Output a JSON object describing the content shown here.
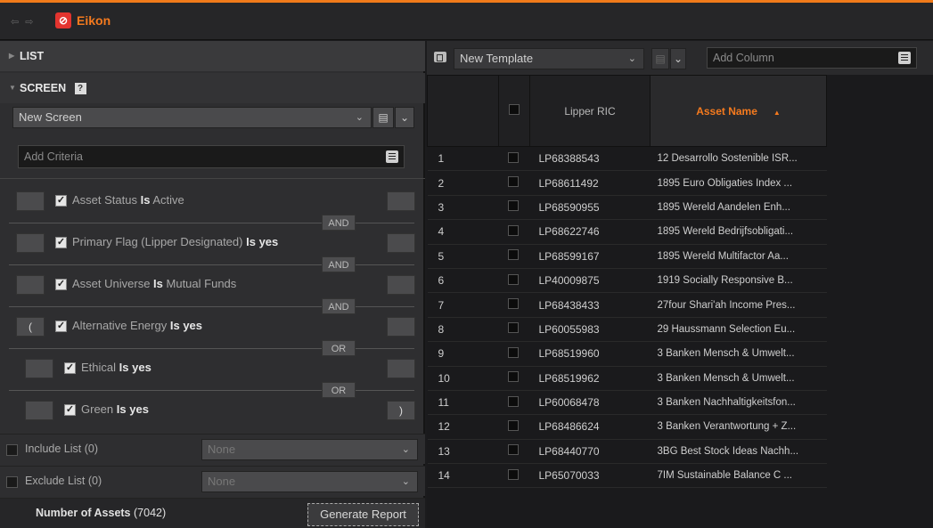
{
  "app": {
    "title": "Eikon",
    "nav": "⇦ ⇨"
  },
  "left": {
    "list_header": "LIST",
    "screen_header": "SCREEN",
    "help_label": "?",
    "screen_select": "New Screen",
    "criteria_placeholder": "Add Criteria",
    "criteria": [
      {
        "paren_left": "",
        "field": "Asset Status",
        "op": "Is",
        "value": "Active",
        "paren_right": "",
        "connector": "AND"
      },
      {
        "paren_left": "",
        "field": "Primary Flag (Lipper Designated)",
        "op": "Is",
        "value": "yes",
        "paren_right": "",
        "connector": "AND"
      },
      {
        "paren_left": "",
        "field": "Asset Universe",
        "op": "Is",
        "value": "Mutual Funds",
        "paren_right": "",
        "connector": "AND"
      },
      {
        "paren_left": "(",
        "field": "Alternative Energy",
        "op": "Is",
        "value": "yes",
        "paren_right": "",
        "connector": "OR"
      },
      {
        "paren_left": "",
        "field": "Ethical",
        "op": "Is",
        "value": "yes",
        "paren_right": "",
        "connector": "OR"
      },
      {
        "paren_left": "",
        "field": "Green",
        "op": "Is",
        "value": "yes",
        "paren_right": ")",
        "connector": ""
      }
    ],
    "include_list": {
      "label": "Include List (0)",
      "value": "None"
    },
    "exclude_list": {
      "label": "Exclude List (0)",
      "value": "None"
    },
    "assets_label": "Number of Assets",
    "assets_count": "(7042)",
    "generate_button": "Generate Report"
  },
  "right": {
    "template_select": "New Template",
    "add_column_placeholder": "Add Column",
    "columns": {
      "ric": "Lipper RIC",
      "asset": "Asset Name"
    },
    "rows": [
      {
        "n": "1",
        "ric": "LP68388543",
        "asset": "12 Desarrollo Sostenible ISR..."
      },
      {
        "n": "2",
        "ric": "LP68611492",
        "asset": "1895 Euro Obligaties Index ..."
      },
      {
        "n": "3",
        "ric": "LP68590955",
        "asset": "1895 Wereld Aandelen Enh..."
      },
      {
        "n": "4",
        "ric": "LP68622746",
        "asset": "1895 Wereld Bedrijfsobligati..."
      },
      {
        "n": "5",
        "ric": "LP68599167",
        "asset": "1895 Wereld Multifactor Aa..."
      },
      {
        "n": "6",
        "ric": "LP40009875",
        "asset": "1919 Socially Responsive B..."
      },
      {
        "n": "7",
        "ric": "LP68438433",
        "asset": "27four Shari'ah Income Pres..."
      },
      {
        "n": "8",
        "ric": "LP60055983",
        "asset": "29 Haussmann Selection Eu..."
      },
      {
        "n": "9",
        "ric": "LP68519960",
        "asset": "3 Banken Mensch & Umwelt..."
      },
      {
        "n": "10",
        "ric": "LP68519962",
        "asset": "3 Banken Mensch & Umwelt..."
      },
      {
        "n": "11",
        "ric": "LP60068478",
        "asset": "3 Banken Nachhaltigkeitsfon..."
      },
      {
        "n": "12",
        "ric": "LP68486624",
        "asset": "3 Banken Verantwortung + Z..."
      },
      {
        "n": "13",
        "ric": "LP68440770",
        "asset": "3BG Best Stock Ideas Nachh..."
      },
      {
        "n": "14",
        "ric": "LP65070033",
        "asset": "7IM Sustainable Balance C ..."
      }
    ]
  }
}
